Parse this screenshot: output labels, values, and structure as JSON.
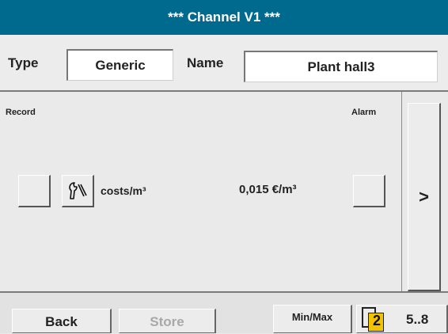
{
  "title": "***  Channel V1  ***",
  "type_label": "Type",
  "type_value": "Generic",
  "name_label": "Name",
  "name_value": "Plant hall3",
  "record_label": "Record",
  "alarm_label": "Alarm",
  "unit_label": "costs/m³",
  "value_text": "0,015 €/m³",
  "next_label": ">",
  "buttons": {
    "back": "Back",
    "store": "Store",
    "minmax": "Min/Max",
    "page_number": "2",
    "page_range": "5..8"
  },
  "colors": {
    "title_bar": "#006a8e",
    "page_badge": "#f2c300"
  },
  "icons": [
    "wrench-icon",
    "pages-icon"
  ]
}
